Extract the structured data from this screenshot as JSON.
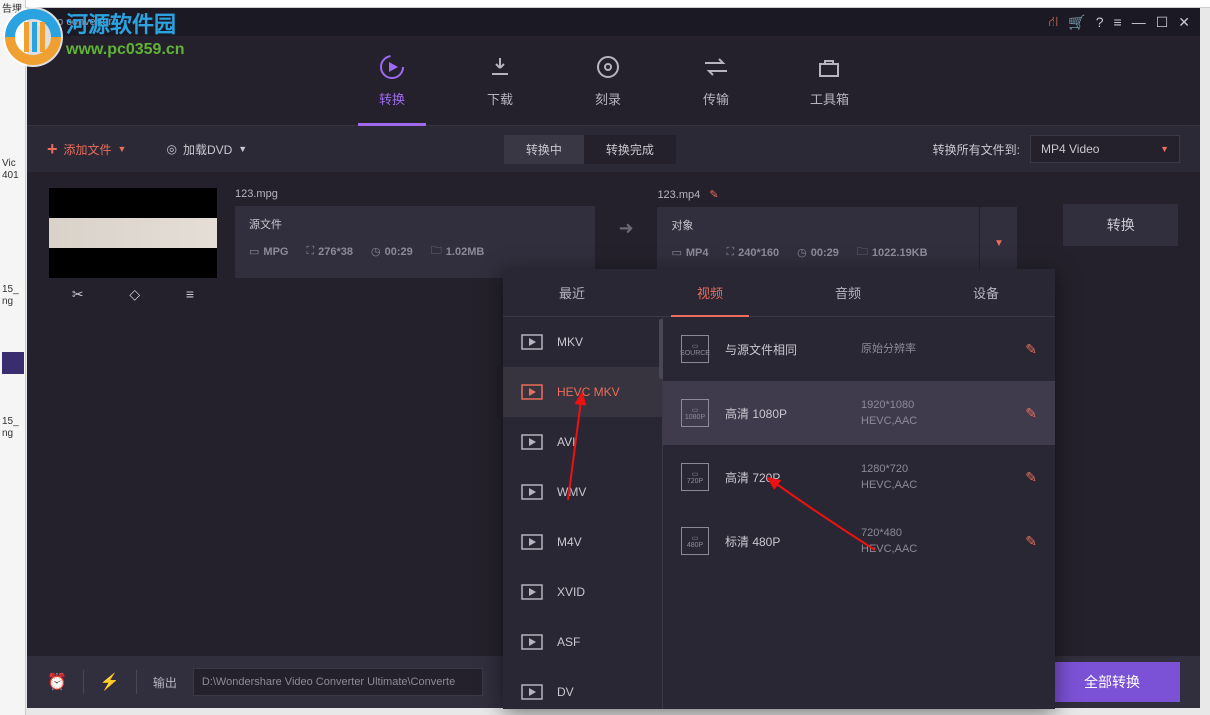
{
  "window_title": "video converter",
  "watermark_url": "www.pc0359.cn",
  "main_tabs": {
    "convert": "转换",
    "download": "下载",
    "burn": "刻录",
    "transfer": "传输",
    "toolbox": "工具箱"
  },
  "toolbar": {
    "add_file": "添加文件",
    "load_dvd": "加载DVD",
    "converting": "转换中",
    "done": "转换完成",
    "convert_all_to": "转换所有文件到:",
    "format": "MP4 Video"
  },
  "source": {
    "filename": "123.mpg",
    "label": "源文件",
    "container": "MPG",
    "dims": "276*38",
    "dur": "00:29",
    "size": "1.02MB"
  },
  "target": {
    "filename": "123.mp4",
    "label": "对象",
    "container": "MP4",
    "dims": "240*160",
    "dur": "00:29",
    "size": "1022.19KB"
  },
  "convert_btn": "转换",
  "panel": {
    "tabs": {
      "recent": "最近",
      "video": "视频",
      "audio": "音频",
      "device": "设备"
    },
    "formats": [
      "MKV",
      "HEVC MKV",
      "AVI",
      "WMV",
      "M4V",
      "XVID",
      "ASF",
      "DV"
    ],
    "active_format": "HEVC MKV",
    "resolutions": [
      {
        "label": "与源文件相同",
        "meta1": "原始分辨率",
        "meta2": "",
        "ico": "SOURCE"
      },
      {
        "label": "高清 1080P",
        "meta1": "1920*1080",
        "meta2": "HEVC,AAC",
        "ico": "1080P"
      },
      {
        "label": "高清 720P",
        "meta1": "1280*720",
        "meta2": "HEVC,AAC",
        "ico": "720P"
      },
      {
        "label": "标清 480P",
        "meta1": "720*480",
        "meta2": "HEVC,AAC",
        "ico": "480P"
      }
    ]
  },
  "footer": {
    "output_label": "输出",
    "output_path": "D:\\Wondershare Video Converter Ultimate\\Converte",
    "convert_all": "全部转换"
  },
  "side_texts": {
    "t1": "告埋",
    "t2": "Vic",
    "t3": "401",
    "t4": "15_",
    "t5": "ng",
    "t6": "15_",
    "t7": "ng"
  }
}
